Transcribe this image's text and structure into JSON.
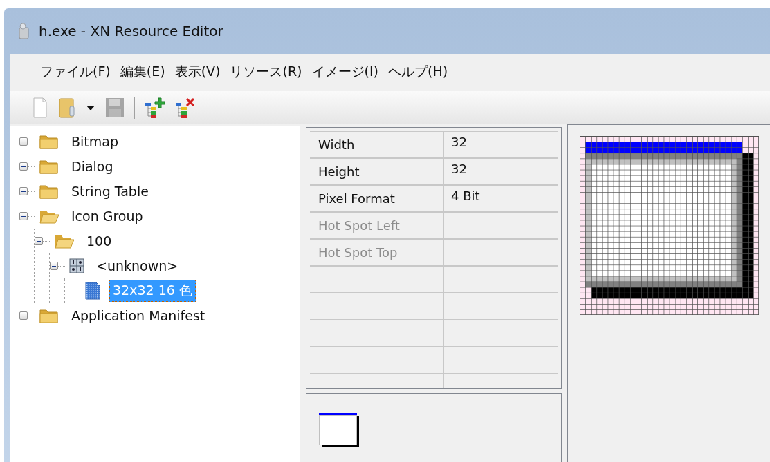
{
  "window": {
    "title": "h.exe - XN Resource Editor"
  },
  "menu": [
    {
      "before": "ファイル(",
      "key": "F",
      "after": ")"
    },
    {
      "before": "編集(",
      "key": "E",
      "after": ")"
    },
    {
      "before": "表示(",
      "key": "V",
      "after": ")"
    },
    {
      "before": "リソース(",
      "key": "R",
      "after": ")"
    },
    {
      "before": "イメージ(",
      "key": "I",
      "after": ")"
    },
    {
      "before": "ヘルプ(",
      "key": "H",
      "after": ")"
    }
  ],
  "toolbar": [
    {
      "kind": "new",
      "disabled": false
    },
    {
      "kind": "open",
      "disabled": false
    },
    {
      "kind": "dropdown",
      "disabled": false
    },
    {
      "kind": "save",
      "disabled": true
    },
    {
      "kind": "separator"
    },
    {
      "kind": "add",
      "disabled": false
    },
    {
      "kind": "delete",
      "disabled": false
    }
  ],
  "tree": [
    {
      "label": "Bitmap",
      "kind": "folder",
      "expanded": false,
      "selected": false
    },
    {
      "label": "Dialog",
      "kind": "folder",
      "expanded": false,
      "selected": false
    },
    {
      "label": "String Table",
      "kind": "folder",
      "expanded": false,
      "selected": false
    },
    {
      "label": "Icon Group",
      "kind": "folder",
      "expanded": true,
      "selected": false,
      "children": [
        {
          "label": "100",
          "kind": "folder",
          "expanded": true,
          "selected": false,
          "children": [
            {
              "label": "<unknown>",
              "kind": "group",
              "expanded": true,
              "selected": false,
              "children": [
                {
                  "label": "32x32 16 色",
                  "kind": "image",
                  "selected": true
                }
              ]
            }
          ]
        }
      ]
    },
    {
      "label": "Application Manifest",
      "kind": "folder",
      "expanded": false,
      "selected": false
    }
  ],
  "properties": [
    {
      "name": "Width",
      "value": "32",
      "disabled": false
    },
    {
      "name": "Height",
      "value": "32",
      "disabled": false
    },
    {
      "name": "Pixel Format",
      "value": "4 Bit",
      "disabled": false
    },
    {
      "name": "Hot Spot Left",
      "disabled": true
    },
    {
      "name": "Hot Spot Top",
      "disabled": true
    }
  ]
}
